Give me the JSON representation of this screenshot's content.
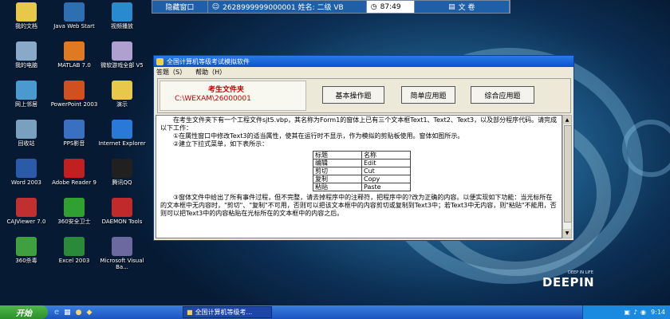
{
  "desktop_icons": [
    {
      "label": "我的文档",
      "icon": "folder-icon",
      "color": "#e8c84a"
    },
    {
      "label": "Java Web Start",
      "icon": "java-icon",
      "color": "#2d6fb0"
    },
    {
      "label": "视频播放",
      "icon": "video-player-icon",
      "color": "#2a8ad0"
    },
    {
      "label": "我的电脑",
      "icon": "computer-icon",
      "color": "#8aa8c8"
    },
    {
      "label": "MATLAB 7.0",
      "icon": "matlab-icon",
      "color": "#e07a20"
    },
    {
      "label": "微软游戏全部 V5",
      "icon": "game-icon",
      "color": "#b0a0d0"
    },
    {
      "label": "网上邻居",
      "icon": "network-icon",
      "color": "#4a9ad0"
    },
    {
      "label": "PowerPoint 2003",
      "icon": "powerpoint-icon",
      "color": "#d05020"
    },
    {
      "label": "演示",
      "icon": "folder-icon",
      "color": "#e8c84a"
    },
    {
      "label": "回收站",
      "icon": "recycle-bin-icon",
      "color": "#7aa0c0"
    },
    {
      "label": "PPS影音",
      "icon": "pps-icon",
      "color": "#3a70c0"
    },
    {
      "label": "Internet Explorer",
      "icon": "ie-icon",
      "color": "#2a78d8"
    },
    {
      "label": "Word 2003",
      "icon": "word-icon",
      "color": "#2a5aa8"
    },
    {
      "label": "Adobe Reader 9",
      "icon": "adobe-reader-icon",
      "color": "#c02020"
    },
    {
      "label": "腾讯QQ",
      "icon": "qq-icon",
      "color": "#202020"
    },
    {
      "label": "CAJViewer 7.0",
      "icon": "cajviewer-icon",
      "color": "#c03030"
    },
    {
      "label": "360安全卫士",
      "icon": "360-safe-icon",
      "color": "#30a030"
    },
    {
      "label": "DAEMON Tools",
      "icon": "daemon-tools-icon",
      "color": "#c02a2a"
    },
    {
      "label": "360杀毒",
      "icon": "360-antivirus-icon",
      "color": "#40a040"
    },
    {
      "label": "Excel 2003",
      "icon": "excel-icon",
      "color": "#2a8a3a"
    },
    {
      "label": "Microsoft Visual Ba...",
      "icon": "visual-basic-icon",
      "color": "#6a6aa0"
    }
  ],
  "topbar": {
    "hide_label": "隐藏窗口",
    "exam_info": "2628999999000001 姓名: 二级 VB",
    "time": "87:49",
    "doc_label": "文 卷"
  },
  "window": {
    "title": "全国计算机等级考试模拟软件",
    "menu": [
      "答题（S）",
      "帮助（H）"
    ],
    "folder_label": "考生文件夹",
    "folder_path": "C:\\WEXAM\\26000001",
    "buttons": [
      "基本操作题",
      "简单应用题",
      "综合应用题"
    ],
    "content": {
      "p1": "在考生文件夹下有一个工程文件sjt5.vbp，其名称为Form1的窗体上已有三个文本框Text1、Text2、Text3，以及部分程序代码。请完成以下工作：",
      "p2": "①在属性窗口中修改Text3的适当属性，使其在运行时不显示，作为模拟的剪贴板使用。窗体如图所示。",
      "p3": "②建立下拉式菜单，如下表所示：",
      "table": [
        [
          "标题",
          "名称"
        ],
        [
          "编辑",
          "Edit"
        ],
        [
          "剪切",
          "Cut"
        ],
        [
          "复制",
          "Copy"
        ],
        [
          "粘贴",
          "Paste"
        ]
      ],
      "p4": "③窗体文件中给出了所有事件过程，但不完整，请去掉程序中的注释符，把程序中的?改为正确的内容。以便实现如下功能：当光标所在的文本框中无内容时，\"剪切\"、\"复制\"不可用，否则可以把该文本框中的内容剪切或复制到Text3中；若Text3中无内容，则\"粘贴\"不能用，否则可以把Text3中的内容粘贴在光标所在的文本框中的内容之后。"
    }
  },
  "taskbar": {
    "start_label": "开始",
    "task_label": "全国计算机等级考...",
    "clock": "9:14"
  },
  "branding": {
    "logo": "DEEPIN",
    "tagline": "DEEP IN LIFE"
  }
}
